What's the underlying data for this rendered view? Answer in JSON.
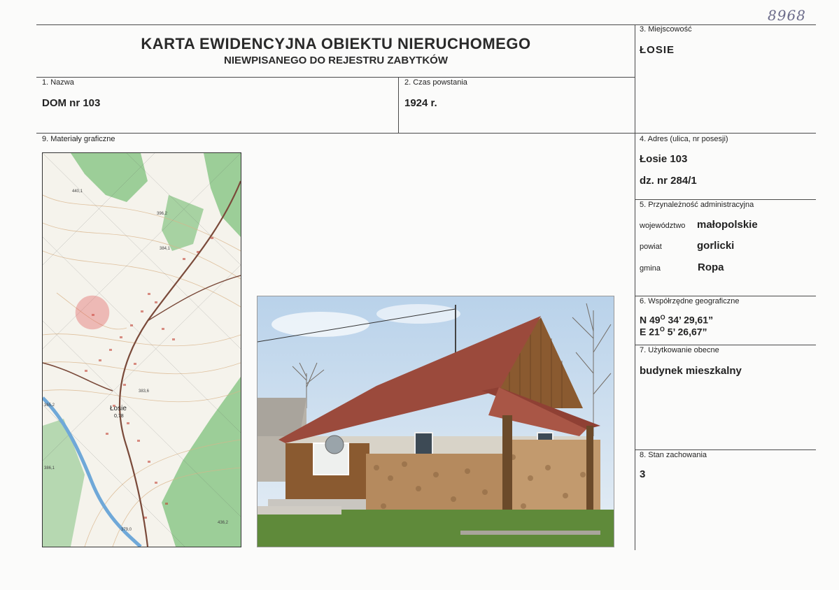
{
  "handwritten_number": "8968",
  "title": {
    "line1": "KARTA EWIDENCYJNA OBIEKTU NIERUCHOMEGO",
    "line2": "NIEWPISANEGO DO REJESTRU ZABYTKÓW"
  },
  "fields": {
    "miejscowosc": {
      "label": "3. Miejscowość",
      "value": "ŁOSIE"
    },
    "nazwa": {
      "label": "1. Nazwa",
      "value": "DOM nr 103"
    },
    "czas": {
      "label": "2. Czas powstania",
      "value": "1924 r."
    },
    "materialy": {
      "label": "9. Materiały graficzne"
    },
    "adres": {
      "label": "4. Adres (ulica, nr posesji)",
      "value1": "Łosie 103",
      "value2": "dz. nr 284/1"
    },
    "przynaleznosc": {
      "label": "5. Przynależność administracyjna",
      "wojewodztwo_label": "województwo",
      "wojewodztwo": "małopolskie",
      "powiat_label": "powiat",
      "powiat": "gorlicki",
      "gmina_label": "gmina",
      "gmina": "Ropa"
    },
    "wspolrzedne": {
      "label": "6. Współrzędne geograficzne",
      "n_prefix": "N 49",
      "n_deg": "O",
      "n_rest": " 34’ 29,61”",
      "e_prefix": "E 21",
      "e_deg": "O",
      "e_rest": " 5’ 26,67”"
    },
    "uzytkowanie": {
      "label": "7. Użytkowanie obecne",
      "value": "budynek mieszkalny"
    },
    "stan": {
      "label": "8. Stan zachowania",
      "value": "3"
    }
  },
  "map": {
    "place_name": "Łosie",
    "place_elev": "0,78",
    "elevations": [
      "440,1",
      "396,2",
      "384,1",
      "383,6",
      "436,2",
      "386,1",
      "379,0",
      "365,2"
    ]
  },
  "colors": {
    "forest": "#8cc78a",
    "road": "#7a4a3a",
    "river": "#6fa8d8",
    "marker": "#e05050",
    "roof": "#9b4a3c",
    "wood": "#8a5a30",
    "sky": "#cfe0ef",
    "grass": "#5f8a3a"
  }
}
